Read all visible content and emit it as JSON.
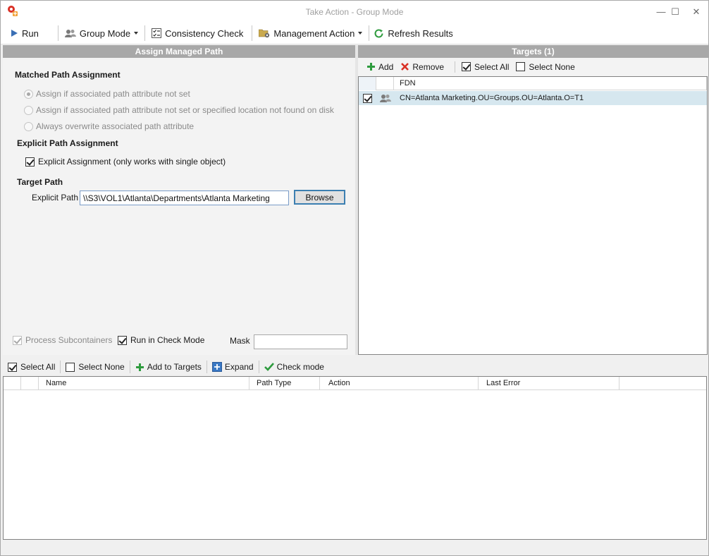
{
  "window": {
    "title": "Take Action - Group Mode",
    "minimize_glyph": "—",
    "maximize_glyph": "☐",
    "close_glyph": "✕"
  },
  "toolbar": {
    "run": "Run",
    "group_mode": "Group Mode",
    "consistency_check": "Consistency Check",
    "management_action": "Management Action",
    "refresh_results": "Refresh Results"
  },
  "left_panel": {
    "header": "Assign Managed Path",
    "matched_title": "Matched Path Assignment",
    "radio_options": [
      {
        "label": "Assign if associated path attribute not set",
        "selected": true
      },
      {
        "label": "Assign if associated path attribute not set or specified location not found on disk",
        "selected": false
      },
      {
        "label": "Always overwrite associated path attribute",
        "selected": false
      }
    ],
    "explicit_title": "Explicit Path Assignment",
    "explicit_checkbox": "Explicit Assignment (only works with single object)",
    "explicit_checked": true,
    "target_title": "Target Path",
    "explicit_path_label": "Explicit Path",
    "explicit_path_value": "\\\\S3\\VOL1\\Atlanta\\Departments\\Atlanta Marketing",
    "browse": "Browse",
    "process_subcontainers": "Process Subcontainers",
    "run_in_check_mode": "Run in Check Mode",
    "mask_label": "Mask",
    "mask_value": ""
  },
  "right_panel": {
    "header": "Targets  (1)",
    "add": "Add",
    "remove": "Remove",
    "select_all": "Select All",
    "select_none": "Select None",
    "column_fdn": "FDN",
    "rows": [
      {
        "checked": true,
        "fdn": "CN=Atlanta Marketing.OU=Groups.OU=Atlanta.O=T1"
      }
    ]
  },
  "bottom": {
    "select_all": "Select All",
    "select_none": "Select None",
    "add_to_targets": "Add to Targets",
    "expand": "Expand",
    "check_mode": "Check mode",
    "columns": [
      "Name",
      "Path Type",
      "Action",
      "Last Error"
    ]
  },
  "colors": {
    "panel_header": "#a8a8a8",
    "selected_row": "#d6e7ef",
    "accent_green": "#2e9b3e",
    "accent_red": "#d93025",
    "accent_blue": "#3c7fb1"
  }
}
